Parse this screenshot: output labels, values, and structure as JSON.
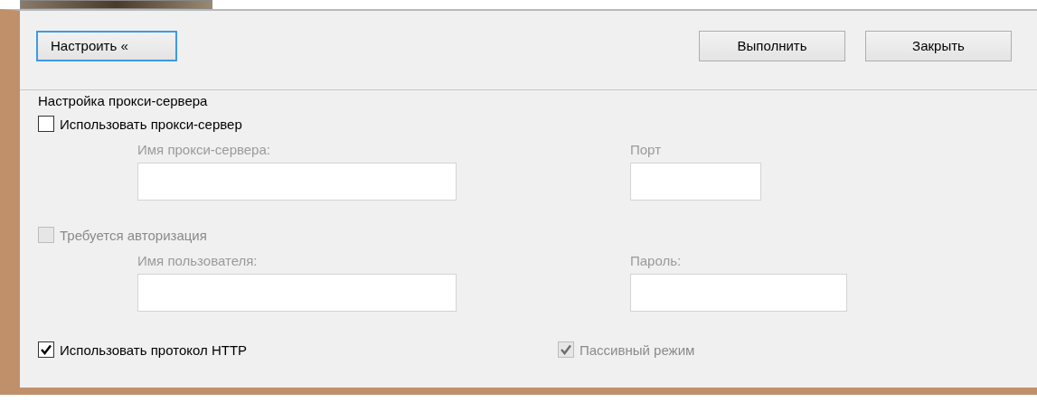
{
  "buttons": [
    {
      "label": "Настроить «",
      "focused": true
    },
    {
      "label": "Выполнить",
      "focused": false
    },
    {
      "label": "Закрыть",
      "focused": false
    }
  ],
  "proxy_group": {
    "title": "Настройка прокси-сервера",
    "use_proxy": {
      "label": "Использовать прокси-сервер",
      "checked": false,
      "disabled": false
    },
    "server_fields": [
      {
        "label": "Имя прокси-сервера:",
        "disabled": true
      },
      {
        "label": "Порт",
        "disabled": true
      }
    ],
    "auth": {
      "label": "Требуется авторизация",
      "checked": false,
      "disabled": true
    },
    "auth_fields": [
      {
        "label": "Имя пользователя:",
        "disabled": true
      },
      {
        "label": "Пароль:",
        "disabled": true
      }
    ],
    "use_http": {
      "label": "Использовать протокол HTTP",
      "checked": true,
      "disabled": false
    },
    "passive_mode": {
      "label": "Пассивный режим",
      "checked": true,
      "disabled": true
    }
  }
}
